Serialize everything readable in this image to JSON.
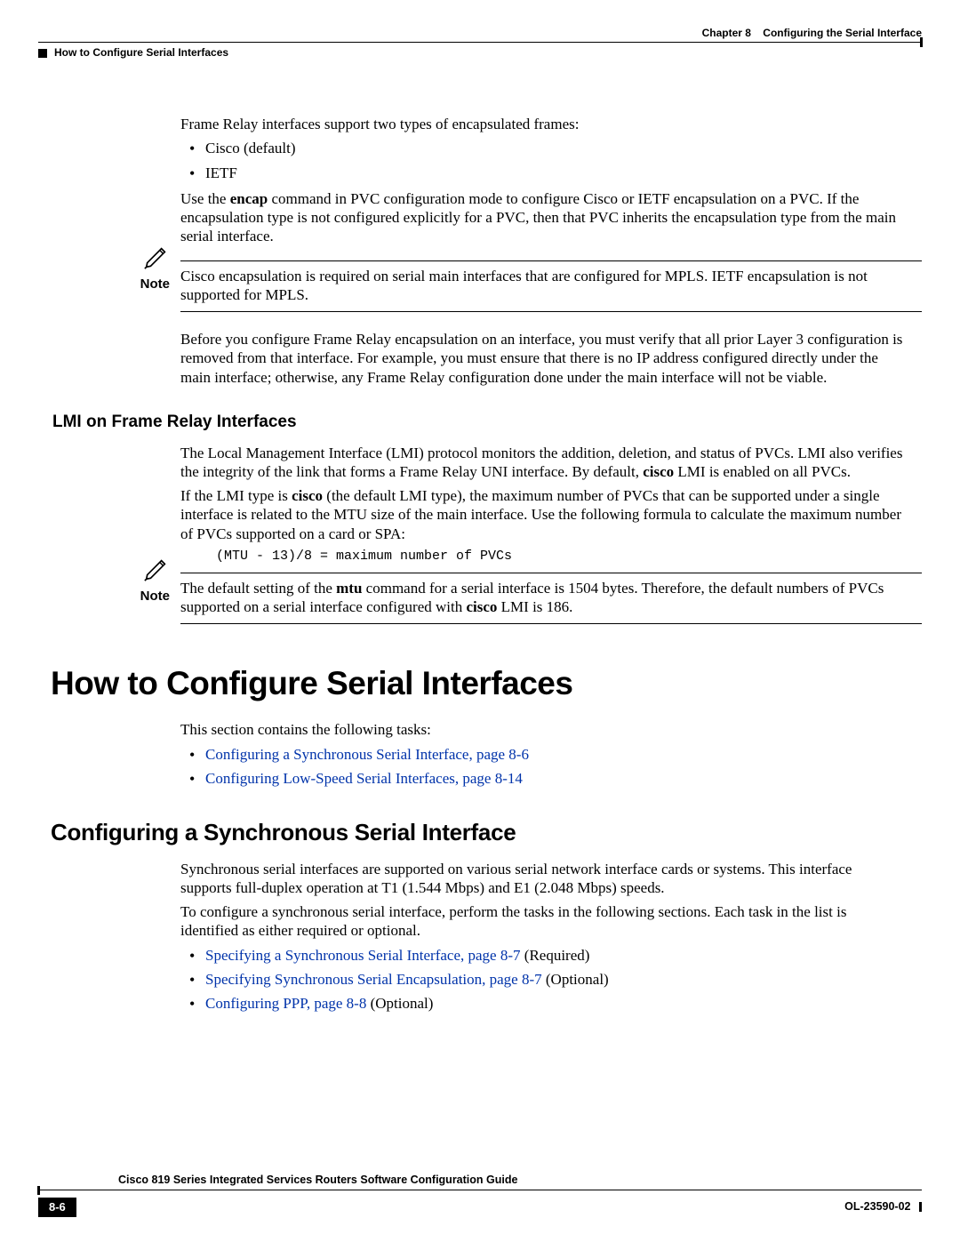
{
  "header": {
    "chapter_label": "Chapter 8",
    "chapter_title": "Configuring the Serial Interface",
    "section_path": "How to Configure Serial Interfaces"
  },
  "intro": {
    "p1": "Frame Relay interfaces support two types of encapsulated frames:",
    "bullets": [
      "Cisco (default)",
      "IETF"
    ],
    "p2_pre": "Use the ",
    "p2_cmd": "encap",
    "p2_post": " command in PVC configuration mode to configure Cisco or IETF encapsulation on a PVC. If the encapsulation type is not configured explicitly for a PVC, then that PVC inherits the encapsulation type from the main serial interface."
  },
  "note1": {
    "label": "Note",
    "text": "Cisco encapsulation is required on serial main interfaces that are configured for MPLS. IETF encapsulation is not supported for MPLS."
  },
  "para_after_note1": "Before you configure Frame Relay encapsulation on an interface, you must verify that all prior Layer 3 configuration is removed from that interface. For example, you must ensure that there is no IP address configured directly under the main interface; otherwise, any Frame Relay configuration done under the main interface will not be viable.",
  "lmi": {
    "heading": "LMI on Frame Relay Interfaces",
    "p1_pre": "The Local Management Interface (LMI) protocol monitors the addition, deletion, and status of PVCs. LMI also verifies the integrity of the link that forms a Frame Relay UNI interface. By default, ",
    "p1_bold": "cisco",
    "p1_post": " LMI is enabled on all PVCs.",
    "p2_pre": "If the LMI type is ",
    "p2_bold": "cisco",
    "p2_post": " (the default LMI type), the maximum number of PVCs that can be supported under a single interface is related to the MTU size of the main interface. Use the following formula to calculate the maximum number of PVCs supported on a card or SPA:",
    "formula": "(MTU - 13)/8 = maximum number of PVCs"
  },
  "note2": {
    "label": "Note",
    "pre": "The default setting of the ",
    "bold1": "mtu",
    "mid": " command for a serial interface is 1504 bytes. Therefore, the default numbers of PVCs supported on a serial interface configured with ",
    "bold2": "cisco",
    "post": " LMI is 186."
  },
  "howto": {
    "heading": "How to Configure Serial Interfaces",
    "intro": "This section contains the following tasks:",
    "links": [
      "Configuring a Synchronous Serial Interface, page 8-6",
      "Configuring Low-Speed Serial Interfaces, page 8-14"
    ]
  },
  "sync": {
    "heading": "Configuring a Synchronous Serial Interface",
    "p1": "Synchronous serial interfaces are supported on various serial network interface cards or systems. This interface supports full-duplex operation at T1 (1.544 Mbps) and E1 (2.048 Mbps) speeds.",
    "p2": "To configure a synchronous serial interface, perform the tasks in the following sections. Each task in the list is identified as either required or optional.",
    "items": [
      {
        "link": "Specifying a Synchronous Serial Interface, page 8-7",
        "suffix": " (Required)"
      },
      {
        "link": "Specifying Synchronous Serial Encapsulation, page 8-7",
        "suffix": " (Optional)"
      },
      {
        "link": "Configuring PPP, page 8-8",
        "suffix": " (Optional)"
      }
    ]
  },
  "footer": {
    "guide_title": "Cisco 819 Series Integrated Services Routers Software Configuration Guide",
    "page_number": "8-6",
    "doc_id": "OL-23590-02"
  }
}
